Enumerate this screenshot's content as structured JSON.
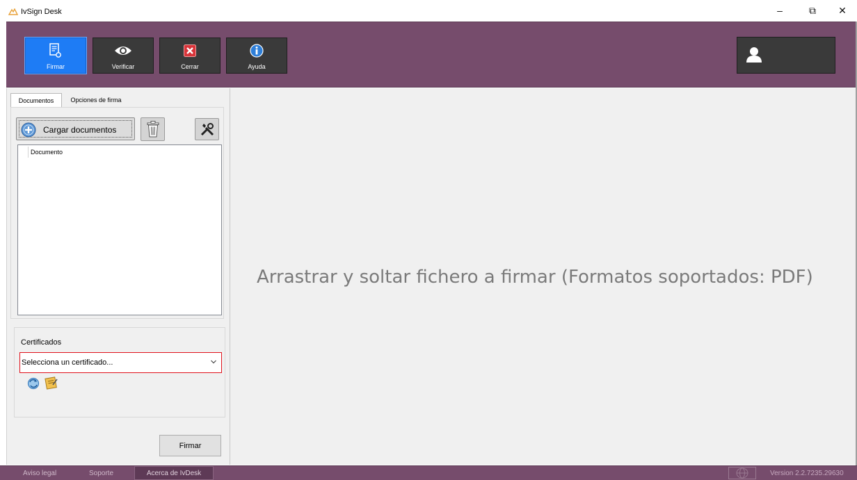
{
  "window": {
    "title": "IvSign Desk",
    "minimize_glyph": "–",
    "maximize_glyph": "⧉",
    "close_glyph": "✕"
  },
  "toolbar": {
    "buttons": [
      {
        "label": "Firmar",
        "icon": "document-sign-icon",
        "active": true
      },
      {
        "label": "Verificar",
        "icon": "eye-icon",
        "active": false
      },
      {
        "label": "Cerrar",
        "icon": "close-icon",
        "active": false
      },
      {
        "label": "Ayuda",
        "icon": "info-icon",
        "active": false
      }
    ],
    "user_icon": "user-icon"
  },
  "left_panel": {
    "tabs": [
      {
        "label": "Documentos",
        "selected": true
      },
      {
        "label": "Opciones de firma",
        "selected": false
      }
    ],
    "cargar_label": "Cargar documentos",
    "trash_icon": "trash-icon",
    "tools_icon": "tools-icon",
    "document_list": {
      "column_header": "Documento",
      "rows": []
    },
    "certificados": {
      "title": "Certificados",
      "selected": "Selecciona un certificado...",
      "refresh_icon": "refresh-icon",
      "notes_icon": "notes-icon"
    },
    "firmar_button": "Firmar"
  },
  "drop_area": {
    "message": "Arrastrar y soltar fichero a firmar (Formatos soportados: PDF)"
  },
  "status_bar": {
    "aviso_legal": "Aviso legal",
    "soporte": "Soporte",
    "acerca": "Acerca de IvDesk",
    "version": "Version 2.2.7235.29630"
  },
  "colors": {
    "toolbar_bg": "#764c6c",
    "active_button": "#1e7cf5",
    "button_bg": "#3a3a3a",
    "cert_border_error": "#e0101a"
  }
}
